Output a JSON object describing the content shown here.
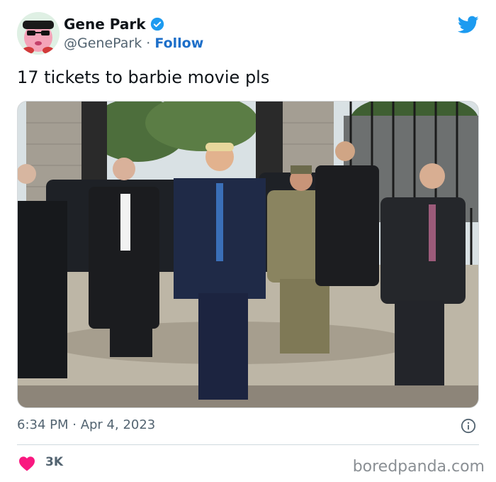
{
  "author": {
    "name": "Gene Park",
    "handle": "@GenePark",
    "separator": "·",
    "follow_label": "Follow",
    "avatar_icon": "pink-character-with-sunglasses-avatar",
    "verified_icon": "verified-badge-icon"
  },
  "tweet": {
    "text": "17 tickets to barbie movie pls",
    "photo_alt": "photo of men in suits and a soldier walking outdoors",
    "timestamp": "6:34 PM · Apr 4, 2023"
  },
  "engagement": {
    "likes": "3K"
  },
  "watermark": "boredpanda.com",
  "colors": {
    "brand_blue": "#1d9bf0",
    "follow_blue": "#1d6fc9",
    "heart_pink": "#f91880",
    "muted": "#536471"
  }
}
